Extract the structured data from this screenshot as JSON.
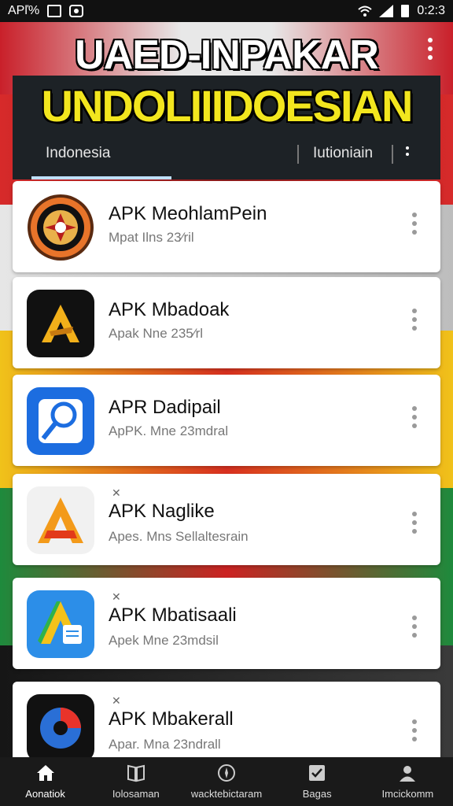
{
  "status_bar": {
    "left_text": "APľ%",
    "time": "0:2:3",
    "icons": [
      "image-icon",
      "app-icon",
      "wifi-icon",
      "signal-icon",
      "battery-icon"
    ]
  },
  "header": {
    "title": "UAED-INPAKAR",
    "subtitle": "UNDOLIIIDOESIAN"
  },
  "tabs": {
    "active": "Indonesia",
    "second": "Iutioniain"
  },
  "apps": [
    {
      "name": "APK MeohlamPein",
      "meta": "Mpat Ilns 23⁄ril",
      "tag": "",
      "icon": "badge-seal-icon"
    },
    {
      "name": "APK Mbadoak",
      "meta": "Apak Nne 235⁄rl",
      "tag": "",
      "icon": "letter-a-gold-icon"
    },
    {
      "name": "APR Dadipail",
      "meta": "ApPK. Mne 23mdral",
      "tag": "",
      "icon": "magnifier-icon"
    },
    {
      "name": "APK Naglike",
      "meta": "Apes. Mns Sellaltesrain",
      "tag": "✕",
      "icon": "letter-a-orange-icon"
    },
    {
      "name": "APK Mbatisaali",
      "meta": "Apek Mne 23mdsil",
      "tag": "✕",
      "icon": "letter-a-blue-icon"
    },
    {
      "name": "APK Mbakerall",
      "meta": "Apar. Mna 23ndrall",
      "tag": "✕",
      "icon": "swirl-icon"
    }
  ],
  "bottom_nav": [
    {
      "label": "Aonatiok",
      "icon": "home-icon"
    },
    {
      "label": "Iolosaman",
      "icon": "book-icon"
    },
    {
      "label": "wacktebictaram",
      "icon": "compass-icon"
    },
    {
      "label": "Bagas",
      "icon": "checkbox-icon"
    },
    {
      "label": "Imcickomm",
      "icon": "person-icon"
    }
  ]
}
